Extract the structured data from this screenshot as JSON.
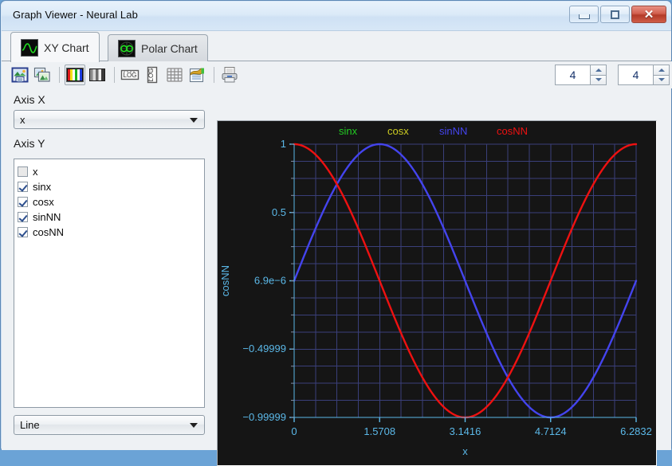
{
  "window": {
    "title": "Graph Viewer - Neural Lab",
    "buttons": {
      "minimize": "minimize-button",
      "restore": "restore-button",
      "close": "close-button"
    }
  },
  "tabs": [
    {
      "label": "XY Chart",
      "icon": "xy-chart-icon",
      "active": true
    },
    {
      "label": "Polar Chart",
      "icon": "polar-chart-icon",
      "active": false
    }
  ],
  "toolbar": {
    "buttons": [
      {
        "name": "save-image-icon",
        "title": "Save image"
      },
      {
        "name": "copy-images-icon",
        "title": "Copy images"
      },
      {
        "name": "color-palette-icon",
        "title": "Color",
        "pressed": true
      },
      {
        "name": "grayscale-palette-icon",
        "title": "Grayscale",
        "pressed": false
      },
      {
        "name": "log-x-icon",
        "title": "LOG"
      },
      {
        "name": "log-y-icon",
        "title": "LOG"
      },
      {
        "name": "grid-icon",
        "title": "Grid"
      },
      {
        "name": "data-table-icon",
        "title": "Data"
      },
      {
        "name": "print-icon",
        "title": "Print"
      }
    ],
    "spinner_left": "4",
    "spinner_right": "4"
  },
  "sidebar": {
    "axis_x_label": "Axis X",
    "axis_x_value": "x",
    "axis_y_label": "Axis Y",
    "series": [
      {
        "label": "x",
        "checked": false
      },
      {
        "label": "sinx",
        "checked": true
      },
      {
        "label": "cosx",
        "checked": true
      },
      {
        "label": "sinNN",
        "checked": true
      },
      {
        "label": "cosNN",
        "checked": true
      }
    ],
    "plot_type_value": "Line"
  },
  "chart_data": {
    "type": "line",
    "title": "",
    "xlabel": "x",
    "ylabel": "cosNN",
    "background": "#151515",
    "grid": true,
    "grid_color": "#3a3f7a",
    "axis_color": "#5bb8e8",
    "legend_position": "top",
    "xlim": [
      0,
      6.2832
    ],
    "ylim": [
      -0.99999,
      1
    ],
    "xticks": [
      0,
      1.5708,
      3.1416,
      4.7124,
      6.2832
    ],
    "xtick_labels": [
      "0",
      "1.5708",
      "3.1416",
      "4.7124",
      "6.2832"
    ],
    "yticks": [
      1,
      0.5,
      6.9e-06,
      -0.49999,
      -0.99999
    ],
    "ytick_labels": [
      "1",
      "0.5",
      "6.9e−6",
      "−0.49999",
      "−0.99999"
    ],
    "series": [
      {
        "name": "sinx",
        "color": "#22cc22",
        "formula": "sin(x)"
      },
      {
        "name": "cosx",
        "color": "#cccc22",
        "formula": "cos(x)"
      },
      {
        "name": "sinNN",
        "color": "#4444ee",
        "formula": "sin(x)"
      },
      {
        "name": "cosNN",
        "color": "#ee1111",
        "formula": "cos(x)"
      }
    ],
    "legend": [
      "sinx",
      "cosx",
      "sinNN",
      "cosNN"
    ]
  }
}
